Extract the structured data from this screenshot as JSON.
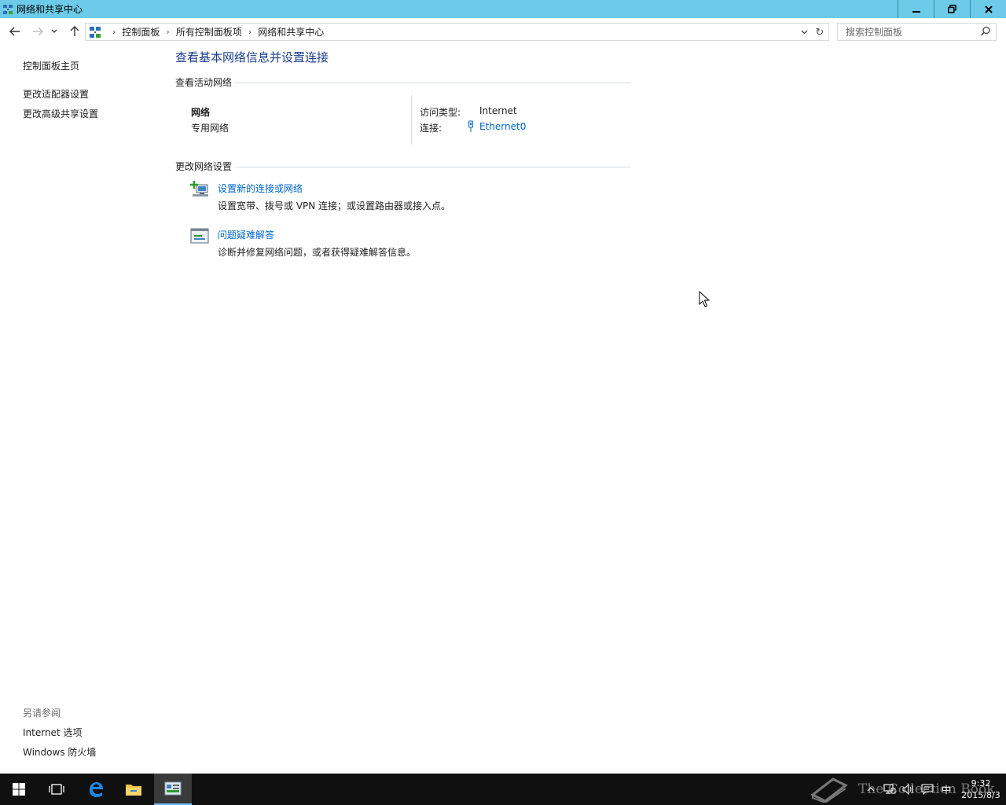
{
  "window": {
    "title": "网络和共享中心",
    "controls": {
      "minimize": "minimize",
      "restore": "restore",
      "close": "close"
    }
  },
  "address_bar": {
    "crumbs": [
      "控制面板",
      "所有控制面板项",
      "网络和共享中心"
    ]
  },
  "search": {
    "placeholder": "搜索控制面板"
  },
  "left_pane": {
    "home": "控制面板主页",
    "links": [
      "更改适配器设置",
      "更改高级共享设置"
    ],
    "see_also_title": "另请参阅",
    "see_also": [
      "Internet 选项",
      "Windows 防火墙"
    ]
  },
  "main": {
    "title": "查看基本网络信息并设置连接",
    "active_networks": {
      "header": "查看活动网络",
      "network_name": "网络",
      "network_type": "专用网络",
      "access_type_label": "访问类型:",
      "access_type_value": "Internet",
      "connection_label": "连接:",
      "connection_value": "Ethernet0"
    },
    "change_settings": {
      "header": "更改网络设置",
      "tasks": [
        {
          "title": "设置新的连接或网络",
          "description": "设置宽带、拨号或 VPN 连接；或设置路由器或接入点。"
        },
        {
          "title": "问题疑难解答",
          "description": "诊断并修复网络问题，或者获得疑难解答信息。"
        }
      ]
    }
  },
  "taskbar": {
    "clock_time": "9:32",
    "clock_date": "2015/8/3",
    "ime": "中"
  },
  "watermark": "The Collection Book",
  "colors": {
    "titlebar": "#6ccbe8",
    "link": "#0066cc",
    "page_title": "#1a3e8c",
    "taskbar": "#101010"
  }
}
